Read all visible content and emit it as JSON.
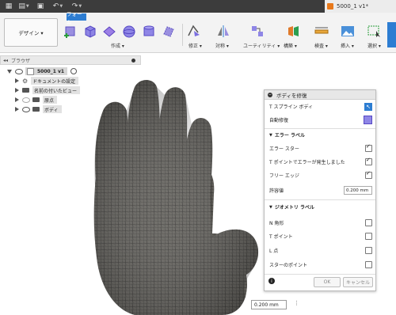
{
  "document": {
    "title": "5000_1 v1*"
  },
  "ribbon": {
    "active_tab": "フォーム",
    "workspace_label": "デザイン ▾",
    "groups": [
      {
        "label": "作成 ▾"
      },
      {
        "label": "修正 ▾"
      },
      {
        "label": "対称 ▾"
      },
      {
        "label": "ユーティリティ ▾"
      },
      {
        "label": "構築 ▾"
      },
      {
        "label": "検査 ▾"
      },
      {
        "label": "挿入 ▾"
      },
      {
        "label": "選択 ▾"
      }
    ]
  },
  "browser": {
    "title": "ブラウザ",
    "root": "5000_1 v1",
    "items": [
      {
        "label": "ドキュメントの設定"
      },
      {
        "label": "名前の付いたビュー"
      },
      {
        "label": "原点"
      },
      {
        "label": "ボディ"
      }
    ]
  },
  "dialog": {
    "title": "ボディを修復",
    "rows": [
      {
        "label": "T スプライン ボディ"
      },
      {
        "label": "自動修復"
      }
    ],
    "section_errors": "エラー ラベル",
    "error_rows": [
      {
        "label": "エラー スター",
        "checked": true
      },
      {
        "label": "T ポイントでエラーが発生しました",
        "checked": true
      },
      {
        "label": "フリー エッジ",
        "checked": true
      }
    ],
    "tolerance_label": "許容値",
    "tolerance_value": "0.200 mm",
    "section_geometry": "ジオメトリ ラベル",
    "geometry_rows": [
      {
        "label": "N 角形",
        "checked": false
      },
      {
        "label": "T ポイント",
        "checked": false
      },
      {
        "label": "L 点",
        "checked": false
      },
      {
        "label": "スターのポイント",
        "checked": false
      }
    ],
    "ok_label": "OK",
    "cancel_label": "キャンセル"
  },
  "viewport": {
    "value_input": "0.200 mm"
  },
  "colors": {
    "accent": "#2d7dd2",
    "mesh": "#5c5a55"
  }
}
